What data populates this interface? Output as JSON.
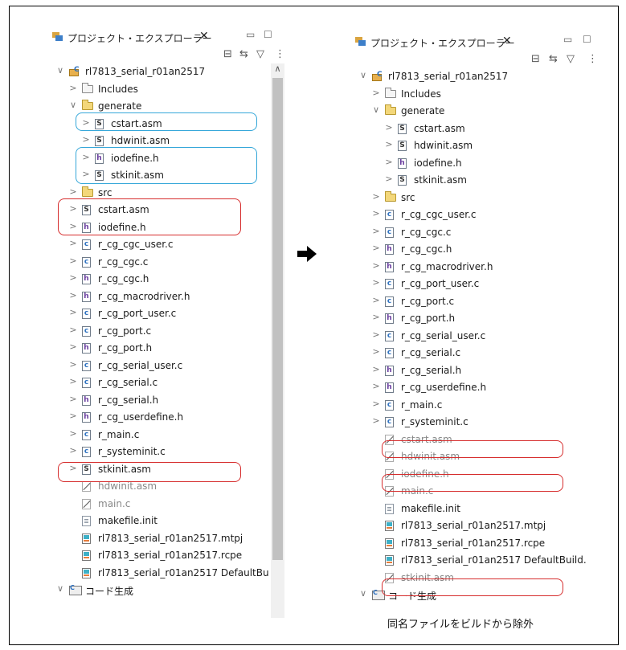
{
  "explorer": {
    "tab_label": "プロジェクト・エクスプローラー",
    "tab_close": "✕",
    "minimize_glyph": "▭",
    "maximize_glyph": "☐",
    "toolbar_icons": [
      "collapse-all-icon",
      "link-with-editor-icon",
      "filter-icon",
      "view-menu-icon"
    ]
  },
  "before_tree": [
    {
      "depth": 0,
      "arrow": "∨",
      "icon": "project",
      "label": "rl7813_serial_r01an2517"
    },
    {
      "depth": 1,
      "arrow": ">",
      "icon": "includes",
      "label": "Includes"
    },
    {
      "depth": 1,
      "arrow": "∨",
      "icon": "folder-open",
      "label": "generate"
    },
    {
      "depth": 2,
      "arrow": ">",
      "icon": "s",
      "label": "cstart.asm"
    },
    {
      "depth": 2,
      "arrow": ">",
      "icon": "s",
      "label": "hdwinit.asm"
    },
    {
      "depth": 2,
      "arrow": ">",
      "icon": "h",
      "label": "iodefine.h"
    },
    {
      "depth": 2,
      "arrow": ">",
      "icon": "s",
      "label": "stkinit.asm"
    },
    {
      "depth": 1,
      "arrow": ">",
      "icon": "folder",
      "label": "src"
    },
    {
      "depth": 1,
      "arrow": ">",
      "icon": "s",
      "label": "cstart.asm"
    },
    {
      "depth": 1,
      "arrow": ">",
      "icon": "h",
      "label": "iodefine.h"
    },
    {
      "depth": 1,
      "arrow": ">",
      "icon": "c",
      "label": "r_cg_cgc_user.c"
    },
    {
      "depth": 1,
      "arrow": ">",
      "icon": "c",
      "label": "r_cg_cgc.c"
    },
    {
      "depth": 1,
      "arrow": ">",
      "icon": "h",
      "label": "r_cg_cgc.h"
    },
    {
      "depth": 1,
      "arrow": ">",
      "icon": "h",
      "label": "r_cg_macrodriver.h"
    },
    {
      "depth": 1,
      "arrow": ">",
      "icon": "c",
      "label": "r_cg_port_user.c"
    },
    {
      "depth": 1,
      "arrow": ">",
      "icon": "c",
      "label": "r_cg_port.c"
    },
    {
      "depth": 1,
      "arrow": ">",
      "icon": "h",
      "label": "r_cg_port.h"
    },
    {
      "depth": 1,
      "arrow": ">",
      "icon": "c",
      "label": "r_cg_serial_user.c"
    },
    {
      "depth": 1,
      "arrow": ">",
      "icon": "c",
      "label": "r_cg_serial.c"
    },
    {
      "depth": 1,
      "arrow": ">",
      "icon": "h",
      "label": "r_cg_serial.h"
    },
    {
      "depth": 1,
      "arrow": ">",
      "icon": "h",
      "label": "r_cg_userdefine.h"
    },
    {
      "depth": 1,
      "arrow": ">",
      "icon": "c",
      "label": "r_main.c"
    },
    {
      "depth": 1,
      "arrow": ">",
      "icon": "c",
      "label": "r_systeminit.c"
    },
    {
      "depth": 1,
      "arrow": ">",
      "icon": "s",
      "label": "stkinit.asm"
    },
    {
      "depth": 1,
      "arrow": "",
      "icon": "excluded",
      "label": "hdwinit.asm",
      "dim": true
    },
    {
      "depth": 1,
      "arrow": "",
      "icon": "excluded",
      "label": "main.c",
      "dim": true
    },
    {
      "depth": 1,
      "arrow": "",
      "icon": "text",
      "label": "makefile.init"
    },
    {
      "depth": 1,
      "arrow": "",
      "icon": "projfile",
      "label": "rl7813_serial_r01an2517.mtpj"
    },
    {
      "depth": 1,
      "arrow": "",
      "icon": "projfile",
      "label": "rl7813_serial_r01an2517.rcpe"
    },
    {
      "depth": 1,
      "arrow": "",
      "icon": "projfile",
      "label": "rl7813_serial_r01an2517 DefaultBu"
    },
    {
      "depth": 0,
      "arrow": "∨",
      "icon": "codegen",
      "label": "コード生成"
    }
  ],
  "after_tree": [
    {
      "depth": 0,
      "arrow": "∨",
      "icon": "project",
      "label": "rl7813_serial_r01an2517"
    },
    {
      "depth": 1,
      "arrow": ">",
      "icon": "includes",
      "label": "Includes"
    },
    {
      "depth": 1,
      "arrow": "∨",
      "icon": "folder-open",
      "label": "generate"
    },
    {
      "depth": 2,
      "arrow": ">",
      "icon": "s",
      "label": "cstart.asm"
    },
    {
      "depth": 2,
      "arrow": ">",
      "icon": "s",
      "label": "hdwinit.asm"
    },
    {
      "depth": 2,
      "arrow": ">",
      "icon": "h",
      "label": "iodefine.h"
    },
    {
      "depth": 2,
      "arrow": ">",
      "icon": "s",
      "label": "stkinit.asm"
    },
    {
      "depth": 1,
      "arrow": ">",
      "icon": "folder",
      "label": "src"
    },
    {
      "depth": 1,
      "arrow": ">",
      "icon": "c",
      "label": "r_cg_cgc_user.c"
    },
    {
      "depth": 1,
      "arrow": ">",
      "icon": "c",
      "label": "r_cg_cgc.c"
    },
    {
      "depth": 1,
      "arrow": ">",
      "icon": "h",
      "label": "r_cg_cgc.h"
    },
    {
      "depth": 1,
      "arrow": ">",
      "icon": "h",
      "label": "r_cg_macrodriver.h"
    },
    {
      "depth": 1,
      "arrow": ">",
      "icon": "c",
      "label": "r_cg_port_user.c"
    },
    {
      "depth": 1,
      "arrow": ">",
      "icon": "c",
      "label": "r_cg_port.c"
    },
    {
      "depth": 1,
      "arrow": ">",
      "icon": "h",
      "label": "r_cg_port.h"
    },
    {
      "depth": 1,
      "arrow": ">",
      "icon": "c",
      "label": "r_cg_serial_user.c"
    },
    {
      "depth": 1,
      "arrow": ">",
      "icon": "c",
      "label": "r_cg_serial.c"
    },
    {
      "depth": 1,
      "arrow": ">",
      "icon": "h",
      "label": "r_cg_serial.h"
    },
    {
      "depth": 1,
      "arrow": ">",
      "icon": "h",
      "label": "r_cg_userdefine.h"
    },
    {
      "depth": 1,
      "arrow": ">",
      "icon": "c",
      "label": "r_main.c"
    },
    {
      "depth": 1,
      "arrow": ">",
      "icon": "c",
      "label": "r_systeminit.c"
    },
    {
      "depth": 1,
      "arrow": "",
      "icon": "excluded",
      "label": "cstart.asm",
      "dim": true
    },
    {
      "depth": 1,
      "arrow": "",
      "icon": "excluded",
      "label": "hdwinit.asm",
      "dim": true
    },
    {
      "depth": 1,
      "arrow": "",
      "icon": "excluded",
      "label": "iodefine.h",
      "dim": true
    },
    {
      "depth": 1,
      "arrow": "",
      "icon": "excluded",
      "label": "main.c",
      "dim": true
    },
    {
      "depth": 1,
      "arrow": "",
      "icon": "text",
      "label": "makefile.init"
    },
    {
      "depth": 1,
      "arrow": "",
      "icon": "projfile",
      "label": "rl7813_serial_r01an2517.mtpj"
    },
    {
      "depth": 1,
      "arrow": "",
      "icon": "projfile",
      "label": "rl7813_serial_r01an2517.rcpe"
    },
    {
      "depth": 1,
      "arrow": "",
      "icon": "projfile",
      "label": "rl7813_serial_r01an2517 DefaultBuild."
    },
    {
      "depth": 1,
      "arrow": "",
      "icon": "excluded",
      "label": "stkinit.asm",
      "dim": true
    },
    {
      "depth": 0,
      "arrow": "∨",
      "icon": "codegen",
      "label": "コード生成"
    }
  ],
  "caption": "同名ファイルをビルドから除外",
  "colors": {
    "blue_highlight": "#35a7d9",
    "red_highlight": "#d62d2d",
    "arrow": "#000000"
  }
}
